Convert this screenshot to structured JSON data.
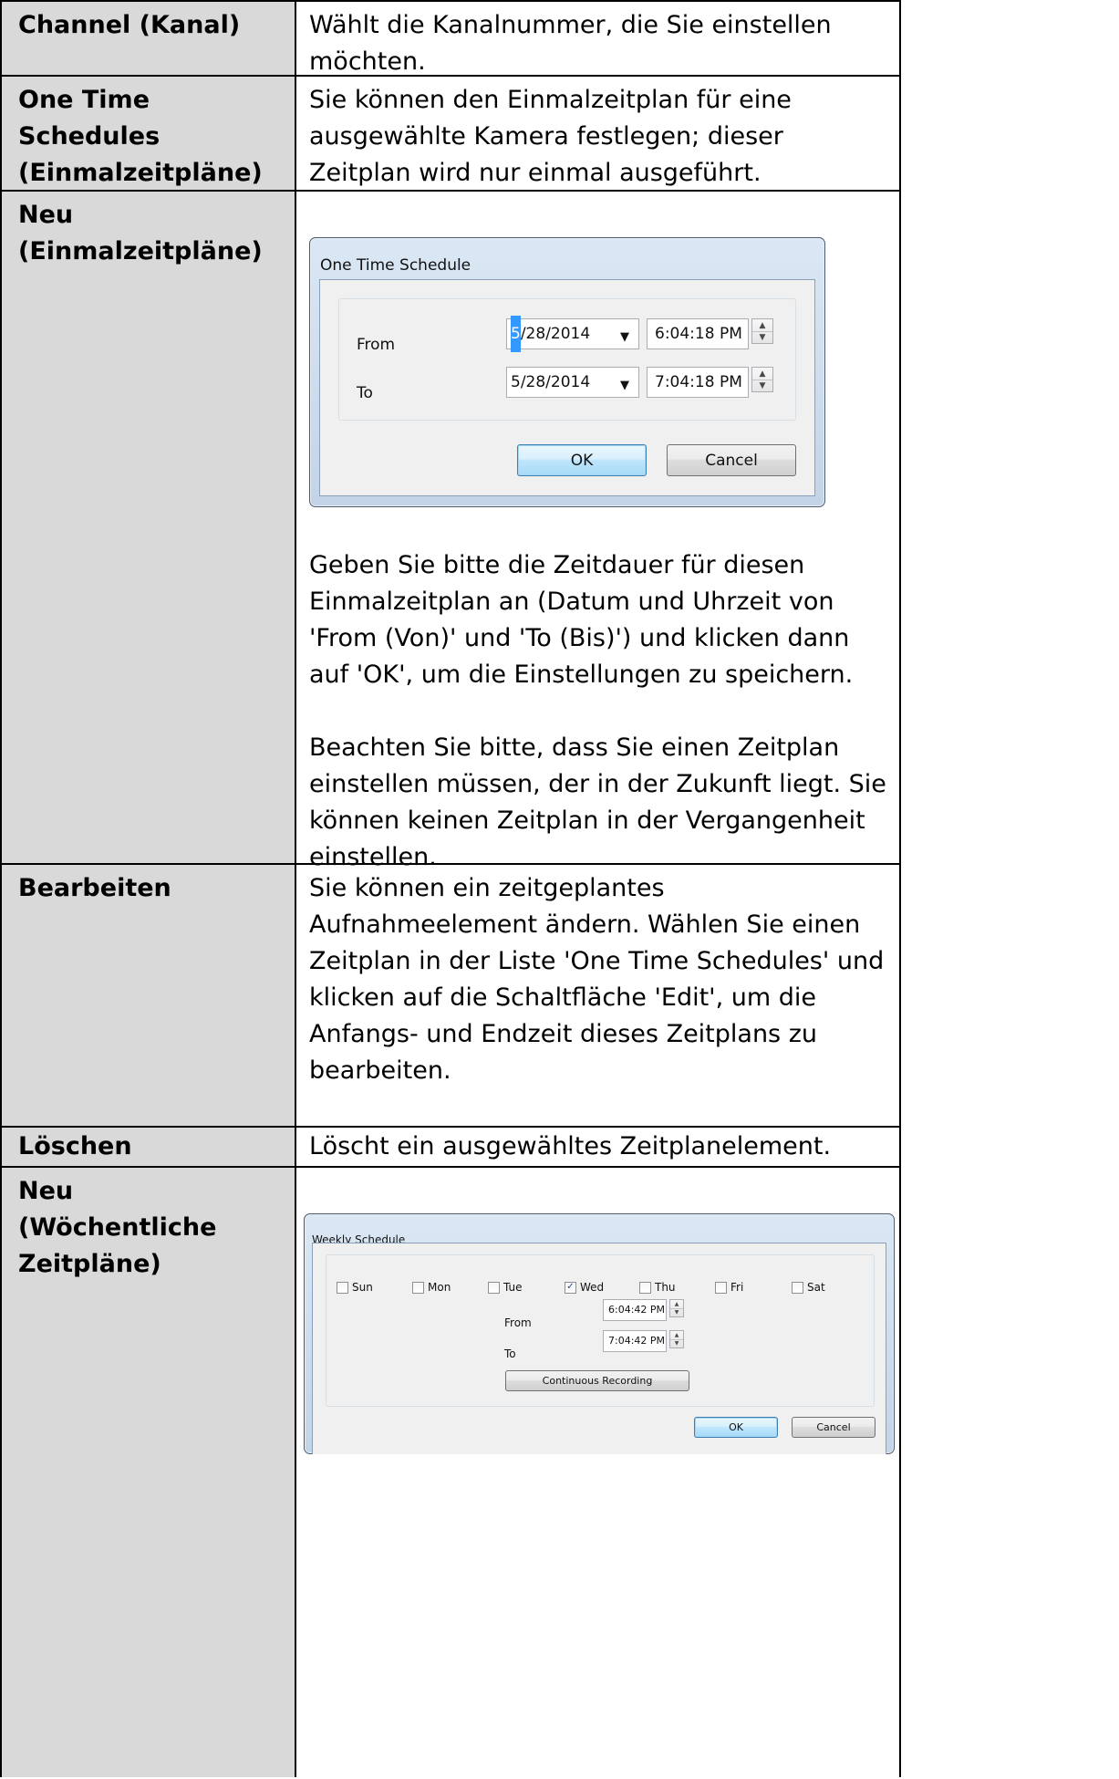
{
  "rows": [
    {
      "label_lines": [
        "Channel (Kanal)"
      ],
      "desc": "Wählt die Kanalnummer, die Sie einstellen möchten."
    },
    {
      "label_lines": [
        "One Time Schedules",
        "(Einmalzeitpläne)"
      ],
      "desc": "Sie können den Einmalzeitplan für eine ausgewählte Kamera festlegen; dieser Zeitplan wird nur einmal ausgeführt."
    },
    {
      "label_lines": [
        "Neu",
        "(Einmalzeitpläne)"
      ],
      "paras": [
        "Geben Sie bitte die Zeitdauer für diesen Einmalzeitplan an (Datum und Uhrzeit von 'From (Von)' und 'To (Bis)') und klicken dann auf 'OK', um die Einstellungen zu speichern.",
        "Beachten Sie bitte, dass Sie einen Zeitplan einstellen müssen, der in der Zukunft liegt. Sie können keinen Zeitplan in der Vergangenheit einstellen."
      ]
    },
    {
      "label_lines": [
        "Bearbeiten"
      ],
      "desc": "Sie können ein zeitgeplantes Aufnahmeelement ändern. Wählen Sie einen Zeitplan in der Liste 'One Time Schedules' und klicken auf die Schaltfläche 'Edit', um die Anfangs- und Endzeit dieses Zeitplans zu bearbeiten."
    },
    {
      "label_lines": [
        "Löschen"
      ],
      "desc": "Löscht ein ausgewähltes Zeitplanelement."
    },
    {
      "label_lines": [
        "Neu",
        "(Wöchentliche",
        "Zeitpläne)"
      ]
    }
  ],
  "one_time_dialog": {
    "title": "One Time Schedule",
    "from_label": "From",
    "to_label": "To",
    "from_date_selected_part": "5",
    "from_date_rest": "/28/2014",
    "from_time": "6:04:18 PM",
    "to_date": "5/28/2014",
    "to_time": "7:04:18 PM",
    "ok": "OK",
    "cancel": "Cancel"
  },
  "weekly_dialog": {
    "title": "Weekly Schedule",
    "days": [
      {
        "label": "Sun",
        "checked": false
      },
      {
        "label": "Mon",
        "checked": false
      },
      {
        "label": "Tue",
        "checked": false
      },
      {
        "label": "Wed",
        "checked": true
      },
      {
        "label": "Thu",
        "checked": false
      },
      {
        "label": "Fri",
        "checked": false
      },
      {
        "label": "Sat",
        "checked": false
      }
    ],
    "from_label": "From",
    "to_label": "To",
    "from_time": "6:04:42 PM",
    "to_time": "7:04:42 PM",
    "continuous": "Continuous Recording",
    "ok": "OK",
    "cancel": "Cancel"
  },
  "icons": {
    "dropdown": "chevron-down-icon",
    "spin_up": "spin-up-icon",
    "spin_down": "spin-down-icon",
    "check": "check-icon"
  }
}
